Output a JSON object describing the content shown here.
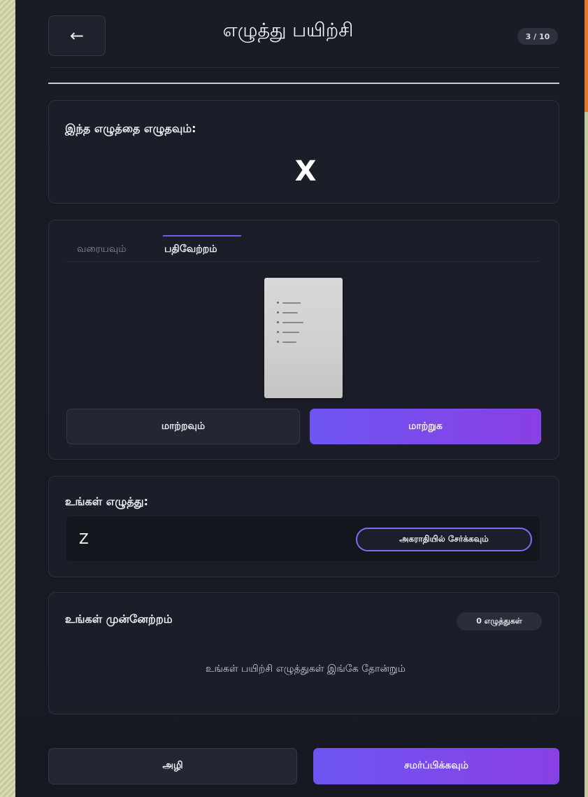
{
  "header": {
    "back_glyph": "←",
    "title": "எழுத்து பயிற்சி",
    "progress": "3 / 10"
  },
  "prompt": {
    "label": "இந்த எழுத்தை எழுதவும்:",
    "character": "X"
  },
  "input_panel": {
    "tabs": [
      {
        "label": "வரையவும்",
        "active": false
      },
      {
        "label": "பதிவேற்றம்",
        "active": true
      }
    ],
    "change_button": "மாற்றவும்",
    "convert_button": "மாற்றுக"
  },
  "your_writing": {
    "label": "உங்கள் எழுத்து:",
    "value": "Z",
    "add_dictionary_button": "அகராதியில் சேர்க்கவும்"
  },
  "progress_panel": {
    "label": "உங்கள் முன்னேற்றம்",
    "count_badge": "0 எழுத்துகள்",
    "empty_message": "உங்கள் பயிற்சி எழுத்துகள் இங்கே தோன்றும்"
  },
  "footer": {
    "clear_button": "அழி",
    "submit_button": "சமர்ப்பிக்கவும்"
  },
  "colors": {
    "background": "#1a1d26",
    "accent_purple": "#6d55f2",
    "accent_violet": "#8a3fe4",
    "card_border": "#2c303c"
  },
  "icons": {
    "back": "arrow-left-icon"
  }
}
